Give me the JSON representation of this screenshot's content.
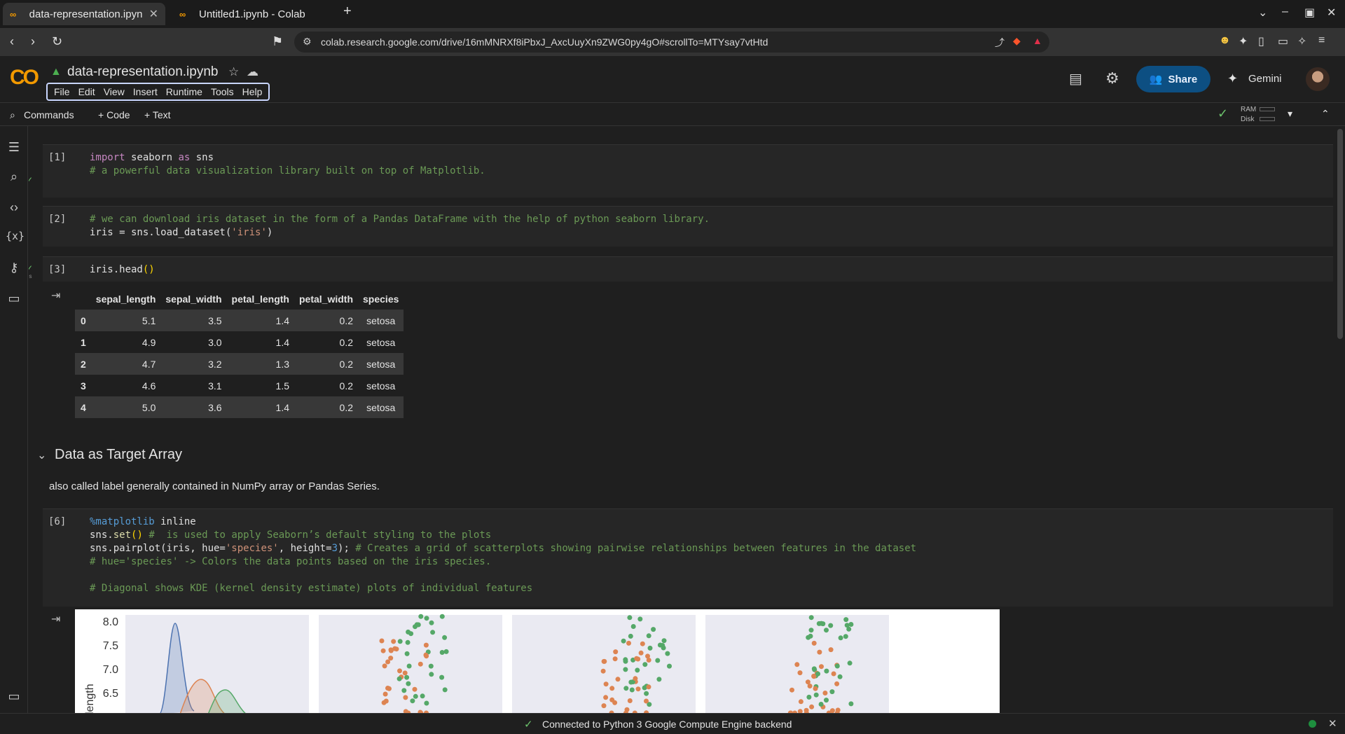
{
  "browser": {
    "tabs": [
      {
        "title": "data-representation.ipyn",
        "active": true
      },
      {
        "title": "Untitled1.ipynb - Colab",
        "active": false
      }
    ],
    "url": "colab.research.google.com/drive/16mMNRXf8iPbxJ_AxcUuyXn9ZWG0py4gO#scrollTo=MTYsay7vtHtd"
  },
  "colab": {
    "logo_text": "CO",
    "notebook_name": "data-representation.ipynb",
    "menu": [
      "File",
      "Edit",
      "View",
      "Insert",
      "Runtime",
      "Tools",
      "Help"
    ],
    "share_label": "Share",
    "gemini_label": "Gemini"
  },
  "toolbar": {
    "commands_label": "Commands",
    "code_label": "+ Code",
    "text_label": "+ Text",
    "ram_label": "RAM",
    "disk_label": "Disk"
  },
  "cells": {
    "c1": {
      "exec": "[1]"
    },
    "c2": {
      "exec": "[2]"
    },
    "c3": {
      "exec": "[3]",
      "duration": "0s"
    },
    "c6": {
      "exec": "[6]"
    }
  },
  "dataframe": {
    "columns": [
      "",
      "sepal_length",
      "sepal_width",
      "petal_length",
      "petal_width",
      "species"
    ],
    "rows": [
      [
        "0",
        "5.1",
        "3.5",
        "1.4",
        "0.2",
        "setosa"
      ],
      [
        "1",
        "4.9",
        "3.0",
        "1.4",
        "0.2",
        "setosa"
      ],
      [
        "2",
        "4.7",
        "3.2",
        "1.3",
        "0.2",
        "setosa"
      ],
      [
        "3",
        "4.6",
        "3.1",
        "1.5",
        "0.2",
        "setosa"
      ],
      [
        "4",
        "5.0",
        "3.6",
        "1.4",
        "0.2",
        "setosa"
      ]
    ]
  },
  "section": {
    "heading": "Data as Target Array",
    "text": "also called label generally contained in NumPy array or Pandas Series."
  },
  "plot": {
    "yticks": [
      "8.0",
      "7.5",
      "7.0",
      "6.5"
    ],
    "ylabel": "length"
  },
  "statusbar": {
    "text": "Connected to Python 3 Google Compute Engine backend"
  },
  "colors": {
    "accent": "#f29900",
    "share": "#0d4f82",
    "setosa": "#4c72b0",
    "versicolor": "#dd8452",
    "virginica": "#55a868"
  }
}
